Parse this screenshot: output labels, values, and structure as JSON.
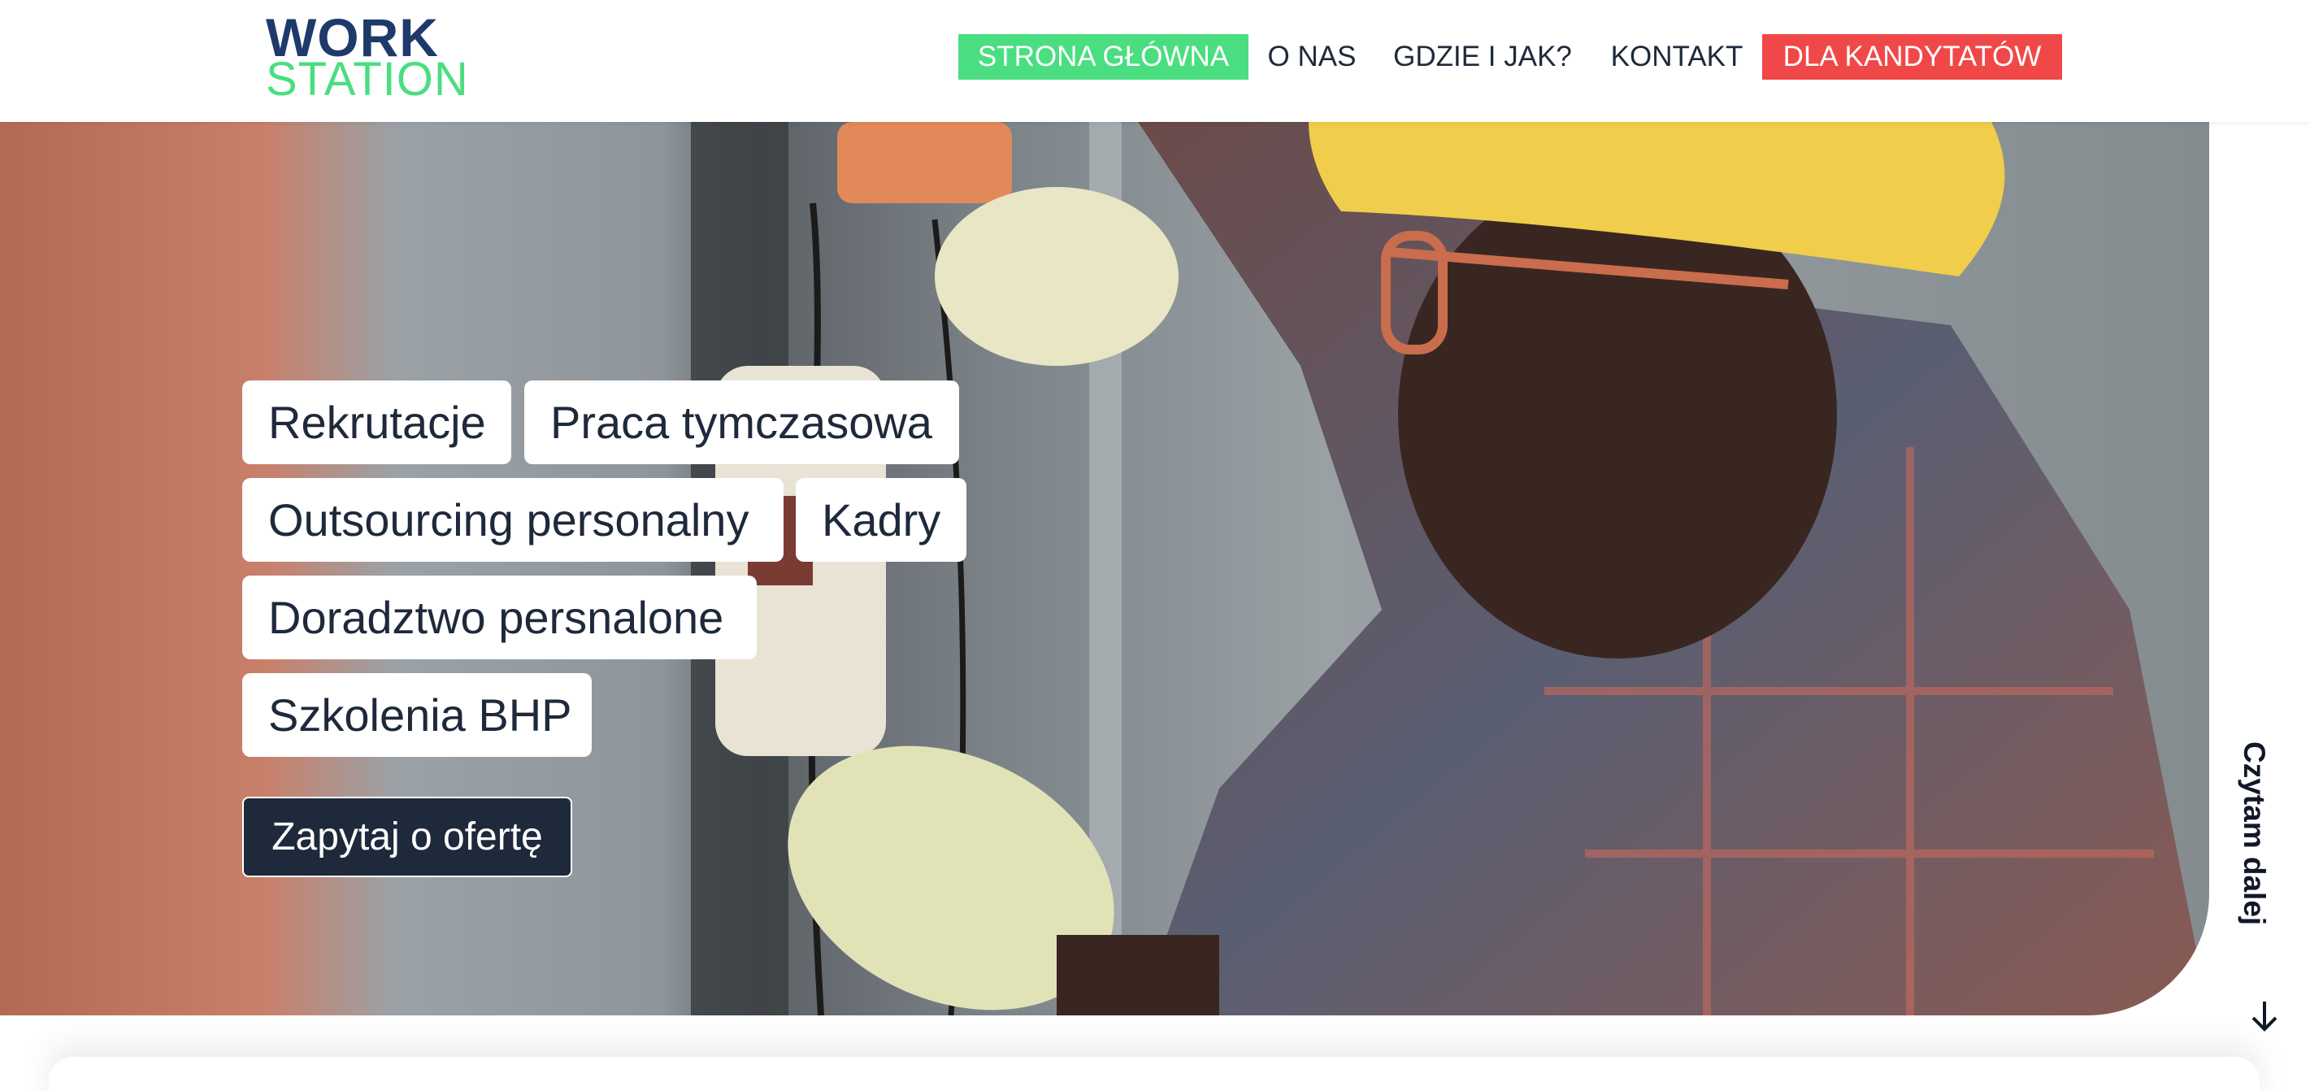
{
  "header": {
    "logo": {
      "line1": "WORK",
      "line2": "STATION"
    },
    "nav": [
      {
        "label": "STRONA GŁÓWNA"
      },
      {
        "label": "O NAS"
      },
      {
        "label": "GDZIE I JAK?"
      },
      {
        "label": "KONTAKT"
      },
      {
        "label": "DLA KANDYTATÓW"
      }
    ]
  },
  "hero": {
    "image": "worker-in-hard-hat-photo",
    "services": [
      "Rekrutacje",
      "Praca tymczasowa",
      "Outsourcing personalny",
      "Kadry",
      "Doradztwo persnalone",
      "Szkolenia BHP"
    ],
    "cta_label": "Zapytaj o ofertę",
    "read_more": "Czytam dalej"
  },
  "colors": {
    "primary_dark": "#1e293b",
    "accent_green": "#4ade80",
    "accent_red": "#f04848",
    "logo_blue": "#1e3a6b"
  }
}
